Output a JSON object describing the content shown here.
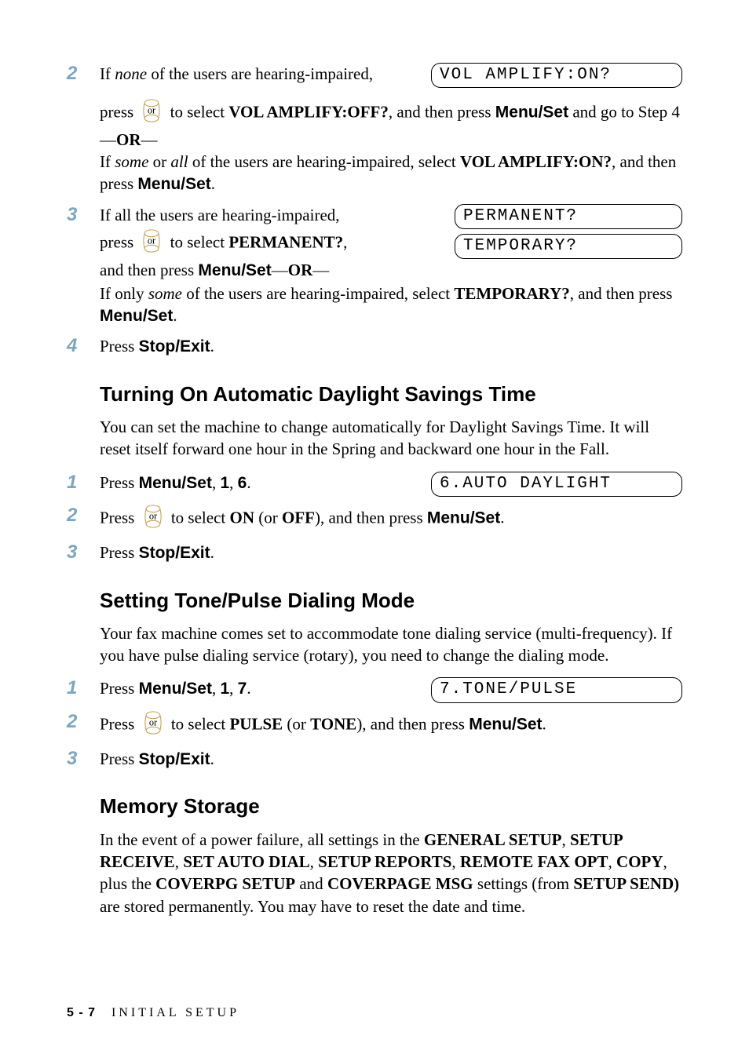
{
  "step2": {
    "num": "2",
    "line1_a": "If ",
    "line1_em": "none",
    "line1_b": " of the users are hearing-impaired,",
    "lcd": "VOL AMPLIFY:ON?",
    "line2_a": " press ",
    "line2_b": " to select ",
    "opt1": "VOL AMPLIFY:OFF?",
    "line2_c": ", and then press ",
    "btn1": "Menu/Set",
    "line2_d": " and go to Step 4—",
    "or": "OR",
    "line2_e": "—",
    "line3_a": "If ",
    "line3_em1": "some",
    "line3_b": " or ",
    "line3_em2": "all",
    "line3_c": " of the users are hearing-impaired, select ",
    "opt2": "VOL AMPLIFY:ON?",
    "line3_d": ", and then press ",
    "btn2": "Menu/Set",
    "line3_e": "."
  },
  "step3": {
    "num": "3",
    "line1": "If all the users are hearing-impaired,",
    "line2_a": "press ",
    "line2_b": " to select ",
    "opt1": "PERMANENT?",
    "line2_c": ",",
    "lcd1": "PERMANENT?",
    "lcd2": "TEMPORARY?",
    "line3_a": "and then press ",
    "btn1": "Menu/Set",
    "line3_b": "—",
    "or": "OR",
    "line3_c": "—",
    "line4_a": "If only ",
    "line4_em": "some",
    "line4_b": " of the users are hearing-impaired, select ",
    "opt2": "TEMPORARY?",
    "line4_c": ", and then press ",
    "btn2": "Menu/Set",
    "line4_d": "."
  },
  "step4": {
    "num": "4",
    "a": "Press ",
    "btn": "Stop/Exit",
    "b": "."
  },
  "h2_daylight": "Turning On Automatic Daylight Savings Time",
  "p_daylight": "You can set the machine to change automatically for Daylight Savings Time. It will reset itself forward one hour in the Spring and backward one hour in the Fall.",
  "daylight_s1": {
    "num": "1",
    "a": "Press ",
    "btn": "Menu/Set",
    "b": ", ",
    "k1": "1",
    "c": ", ",
    "k2": "6",
    "d": ".",
    "lcd": "6.AUTO DAYLIGHT"
  },
  "daylight_s2": {
    "num": "2",
    "a": "Press ",
    "b": " to select ",
    "opt1": "ON",
    "c": " (or ",
    "opt2": "OFF",
    "d": "), and then press ",
    "btn": "Menu/Set",
    "e": "."
  },
  "daylight_s3": {
    "num": "3",
    "a": "Press ",
    "btn": "Stop/Exit",
    "b": "."
  },
  "h2_tone": "Setting Tone/Pulse Dialing Mode",
  "p_tone": "Your fax machine comes set to accommodate tone dialing service (multi-frequency). If you have pulse dialing service (rotary), you need to change the dialing mode.",
  "tone_s1": {
    "num": "1",
    "a": "Press ",
    "btn": "Menu/Set",
    "b": ", ",
    "k1": "1",
    "c": ", ",
    "k2": "7",
    "d": ".",
    "lcd": "7.TONE/PULSE"
  },
  "tone_s2": {
    "num": "2",
    "a": "Press ",
    "b": " to select ",
    "opt1": "PULSE",
    "c": " (or ",
    "opt2": "TONE",
    "d": "), and then press ",
    "btn": "Menu/Set",
    "e": "."
  },
  "tone_s3": {
    "num": "3",
    "a": "Press ",
    "btn": "Stop/Exit",
    "b": "."
  },
  "h2_memory": "Memory Storage",
  "p_memory_a": "In the event of a power failure, all settings in the ",
  "m1": "GENERAL SETUP",
  "p_memory_b": ", ",
  "m2": "SETUP RECEIVE",
  "p_memory_c": ", ",
  "m3": "SET AUTO DIAL",
  "p_memory_d": ", ",
  "m4": "SETUP REPORTS",
  "p_memory_e": ", ",
  "m5": "REMOTE FAX OPT",
  "p_memory_f": ", ",
  "m6": "COPY",
  "p_memory_g": ", plus the ",
  "m7": "COVERPG SETUP",
  "p_memory_h": " and ",
  "m8": "COVERPAGE MSG",
  "p_memory_i": " settings (from ",
  "m9": "SETUP SEND)",
  "p_memory_j": " are stored permanently. You may have to reset the date and time.",
  "footer_page": "5 - 7",
  "footer_section": "INITIAL SETUP"
}
